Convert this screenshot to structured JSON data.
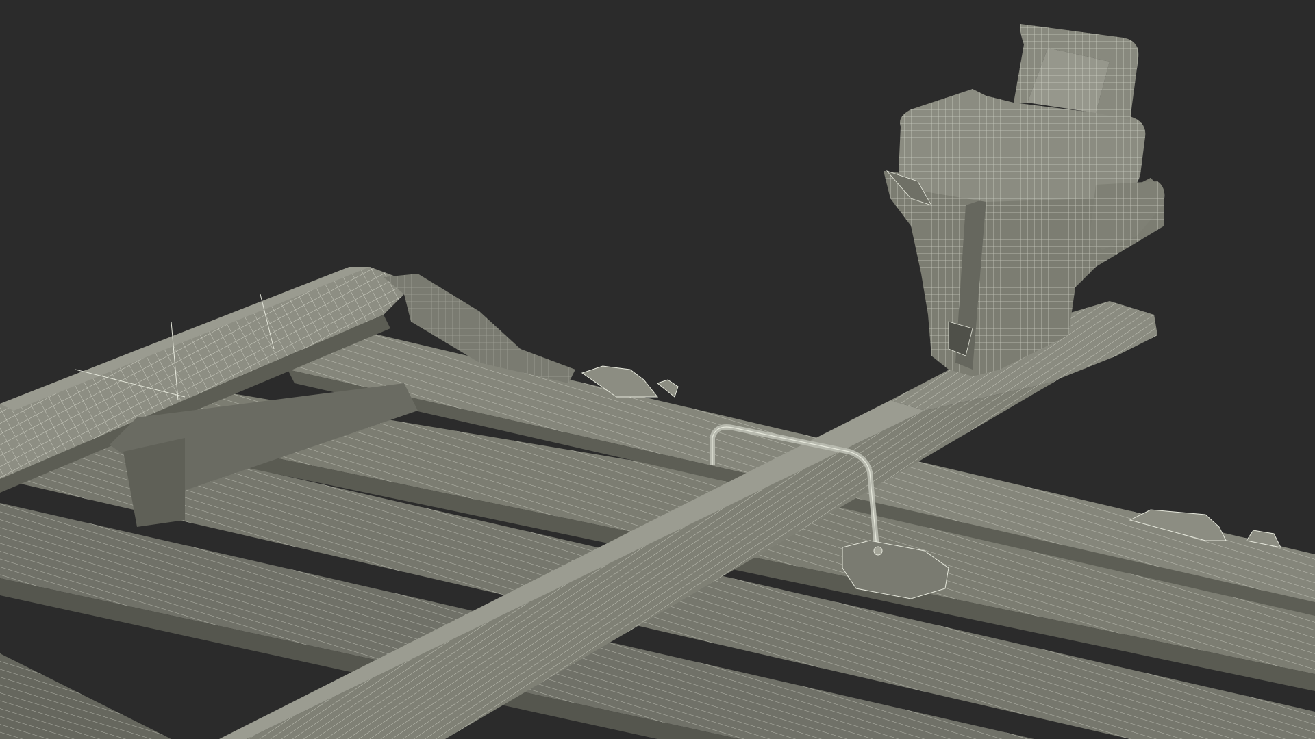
{
  "scene": {
    "subject": "wireframe-render",
    "colors": {
      "background": "#2b2b2b",
      "surface_light": "#8a8b7f",
      "surface_mid": "#727368",
      "surface_dark": "#5c5d54",
      "surface_shadow": "#4a4b44",
      "wire": "#e6e8dc"
    }
  }
}
